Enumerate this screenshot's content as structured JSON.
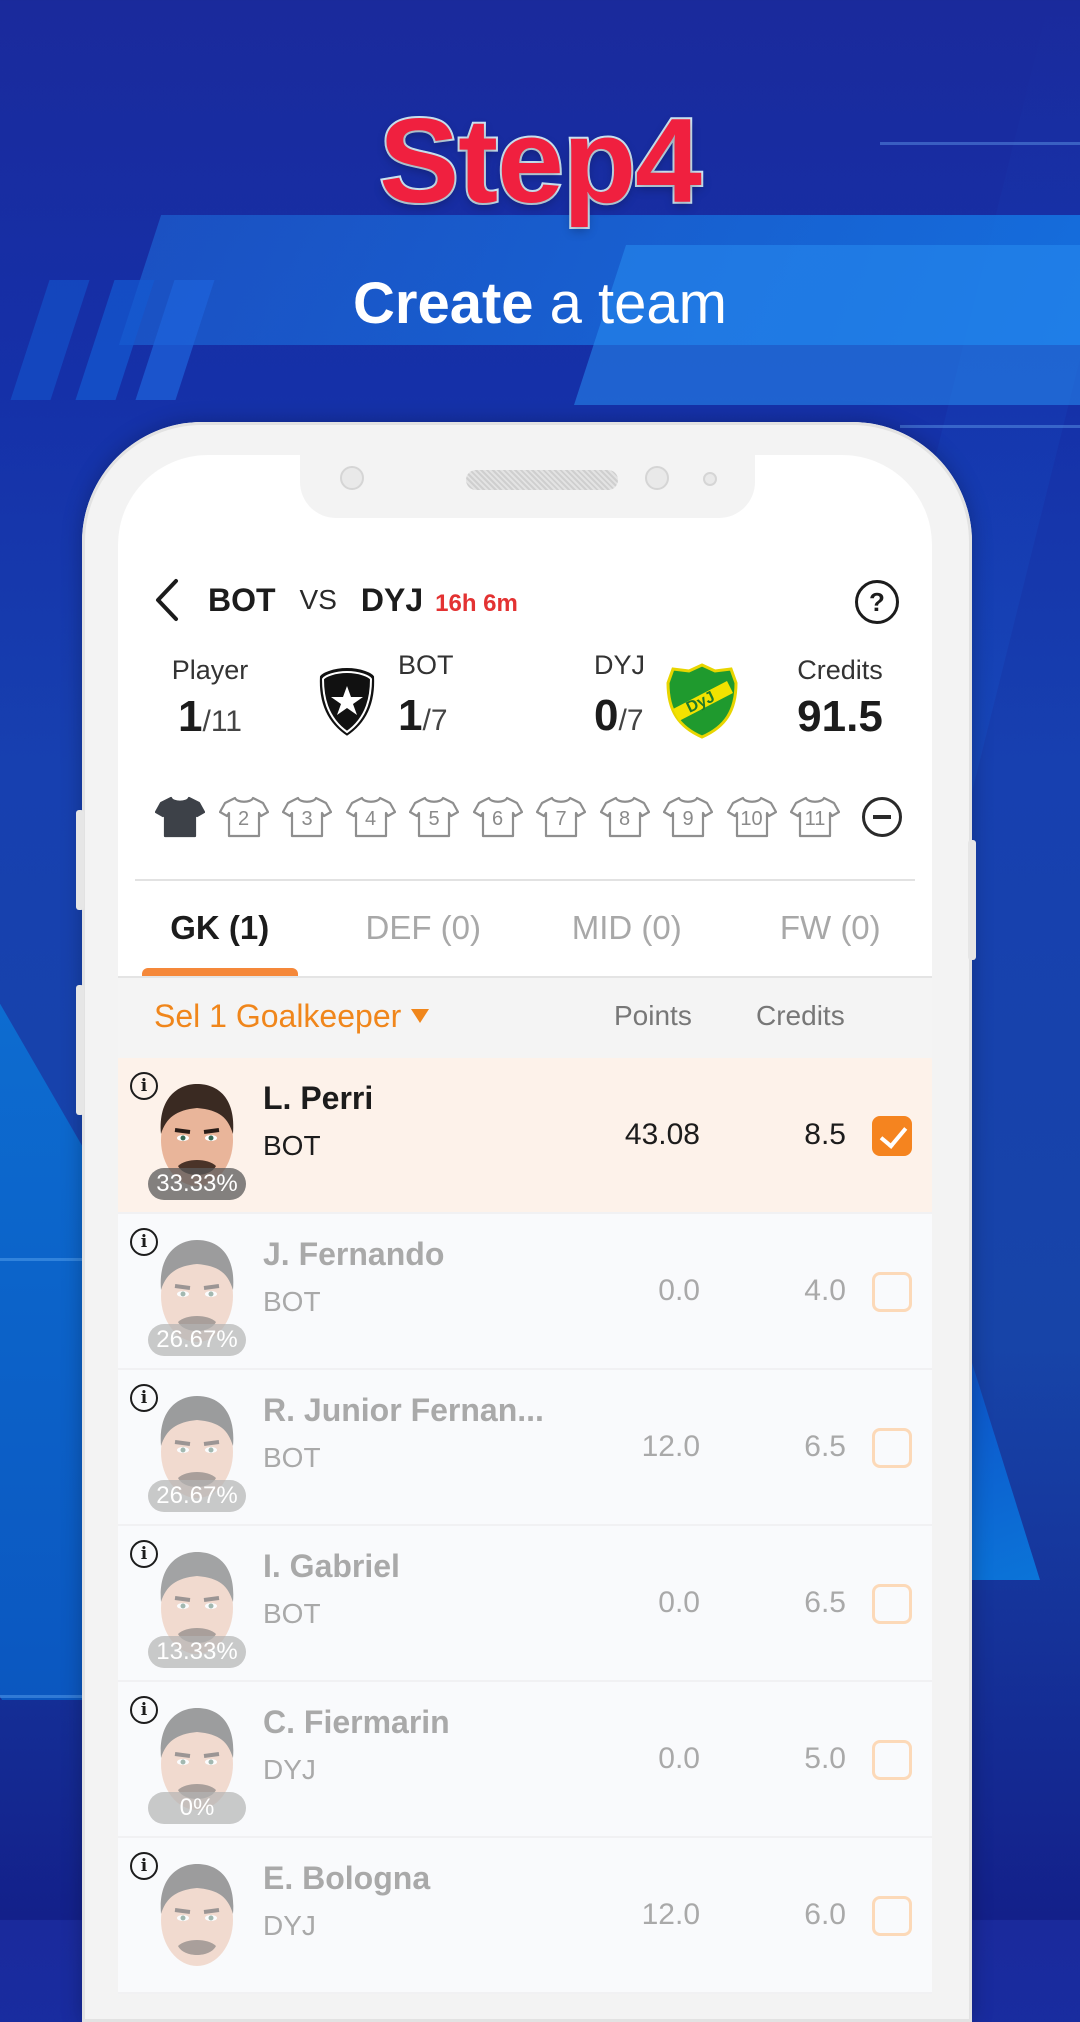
{
  "banner": {
    "step": "Step4",
    "subtitle_bold": "Create",
    "subtitle_rest": " a team"
  },
  "header": {
    "team_home": "BOT",
    "vs": "VS",
    "team_away": "DYJ",
    "countdown": "16h 6m",
    "help_label": "?"
  },
  "summary": {
    "player_label": "Player",
    "player_count": "1",
    "player_total": "/11",
    "home_label": "BOT",
    "home_count": "1",
    "home_total": "/7",
    "away_label": "DYJ",
    "away_count": "0",
    "away_total": "/7",
    "credits_label": "Credits",
    "credits_value": "91.5",
    "away_badge_text": "DyJ"
  },
  "jerseys": {
    "filled": 1,
    "slots": [
      "",
      "2",
      "3",
      "4",
      "5",
      "6",
      "7",
      "8",
      "9",
      "10",
      "11"
    ]
  },
  "tabs": [
    {
      "label": "GK (1)",
      "active": true
    },
    {
      "label": "DEF (0)",
      "active": false
    },
    {
      "label": "MID (0)",
      "active": false
    },
    {
      "label": "FW (0)",
      "active": false
    }
  ],
  "list_header": {
    "filter_label": "Sel 1 Goalkeeper",
    "points_label": "Points",
    "credits_label": "Credits"
  },
  "players": [
    {
      "name": "L. Perri",
      "team": "BOT",
      "selected_by": "33.33%",
      "points": "43.08",
      "credits": "8.5",
      "selected": true
    },
    {
      "name": "J. Fernando",
      "team": "BOT",
      "selected_by": "26.67%",
      "points": "0.0",
      "credits": "4.0",
      "selected": false
    },
    {
      "name": "R. Junior Fernan...",
      "team": "BOT",
      "selected_by": "26.67%",
      "points": "12.0",
      "credits": "6.5",
      "selected": false
    },
    {
      "name": "I. Gabriel",
      "team": "BOT",
      "selected_by": "13.33%",
      "points": "0.0",
      "credits": "6.5",
      "selected": false
    },
    {
      "name": "C. Fiermarin",
      "team": "DYJ",
      "selected_by": "0%",
      "points": "0.0",
      "credits": "5.0",
      "selected": false
    },
    {
      "name": "E. Bologna",
      "team": "DYJ",
      "selected_by": "",
      "points": "12.0",
      "credits": "6.0",
      "selected": false
    }
  ],
  "colors": {
    "accent_orange": "#f5841f",
    "countdown_red": "#e33232",
    "title_red": "#f0203f"
  }
}
